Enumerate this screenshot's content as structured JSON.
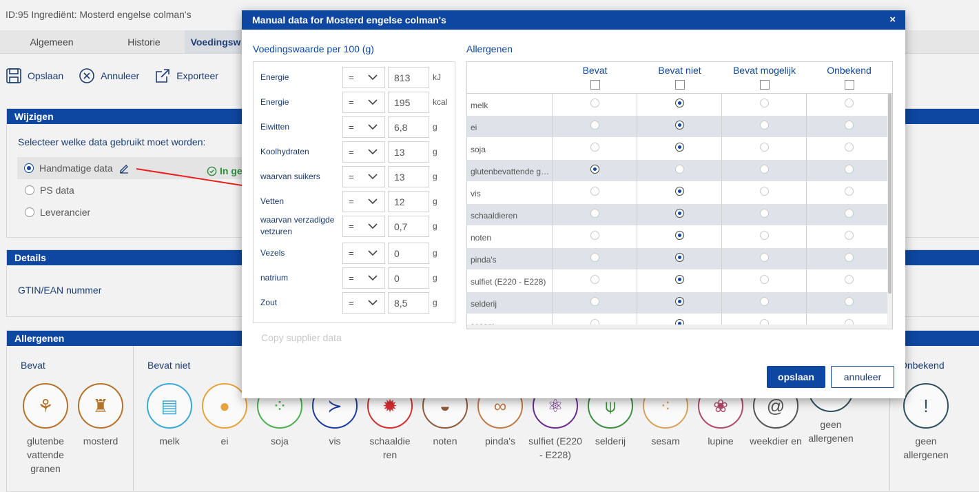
{
  "background": {
    "title": "ID:95   Ingrediënt: Mosterd engelse colman's",
    "tabs": [
      "Algemeen",
      "Historie",
      "Voedingsw"
    ],
    "toolbar": {
      "save": "Opslaan",
      "cancel": "Annuleer",
      "export": "Exporteer"
    },
    "wijzigen": {
      "header": "Wijzigen",
      "question": "Selecteer welke data gebruikt moet worden:",
      "options": [
        "Handmatige data",
        "PS data",
        "Leverancier"
      ],
      "in_use": "In ge"
    },
    "details": {
      "header": "Details",
      "gtin_label": "GTIN/EAN nummer"
    },
    "allergenen": {
      "header": "Allergenen",
      "groups": {
        "bevat": {
          "label": "Bevat",
          "items": [
            "glutenbe vattende granen",
            "mosterd"
          ]
        },
        "bevat_niet": {
          "label": "Bevat niet",
          "items": [
            "melk",
            "ei",
            "soja",
            "vis",
            "schaaldie ren",
            "noten",
            "pinda's",
            "sulfiet (E220 - E228)",
            "selderij",
            "sesam",
            "lupine",
            "weekdier en",
            "geen allergenen"
          ]
        },
        "onbekend": {
          "label": "Onbekend",
          "items": [
            "geen allergenen"
          ]
        }
      }
    }
  },
  "modal": {
    "title": "Manual data for Mosterd engelse colman's",
    "close": "×",
    "nutrition_title": "Voedingswaarde per 100 (g)",
    "nutrients": [
      {
        "label": "Energie",
        "op": "=",
        "value": "813",
        "unit": "kJ"
      },
      {
        "label": "Energie",
        "op": "=",
        "value": "195",
        "unit": "kcal"
      },
      {
        "label": "Eiwitten",
        "op": "=",
        "value": "6,8",
        "unit": "g"
      },
      {
        "label": "Koolhydraten",
        "op": "=",
        "value": "13",
        "unit": "g"
      },
      {
        "label": "waarvan suikers",
        "op": "=",
        "value": "13",
        "unit": "g"
      },
      {
        "label": "Vetten",
        "op": "=",
        "value": "12",
        "unit": "g"
      },
      {
        "label": "waarvan verzadigde vetzuren",
        "op": "=",
        "value": "0,7",
        "unit": "g"
      },
      {
        "label": "Vezels",
        "op": "=",
        "value": "0",
        "unit": "g"
      },
      {
        "label": "natrium",
        "op": "=",
        "value": "0",
        "unit": "g"
      },
      {
        "label": "Zout",
        "op": "=",
        "value": "8,5",
        "unit": "g"
      }
    ],
    "copy_supplier": "Copy supplier data",
    "allergen_title": "Allergenen",
    "allergen_columns": [
      "Bevat",
      "Bevat niet",
      "Bevat mogelijk",
      "Onbekend"
    ],
    "allergen_rows": [
      {
        "name": "melk",
        "selected": 1
      },
      {
        "name": "ei",
        "selected": 1
      },
      {
        "name": "soja",
        "selected": 1
      },
      {
        "name": "glutenbevattende granen",
        "selected": 0
      },
      {
        "name": "vis",
        "selected": 1
      },
      {
        "name": "schaaldieren",
        "selected": 1
      },
      {
        "name": "noten",
        "selected": 1
      },
      {
        "name": "pinda's",
        "selected": 1
      },
      {
        "name": "sulfiet (E220 - E228)",
        "selected": 1
      },
      {
        "name": "selderij",
        "selected": 1
      },
      {
        "name": "sesam",
        "selected": 1
      }
    ],
    "save": "opslaan",
    "cancel": "annuleer"
  },
  "colors": {
    "primary": "#0d47a1",
    "success": "#2e8b3d",
    "row_alt": "#dde3e8",
    "arrow": "#e8211d"
  }
}
